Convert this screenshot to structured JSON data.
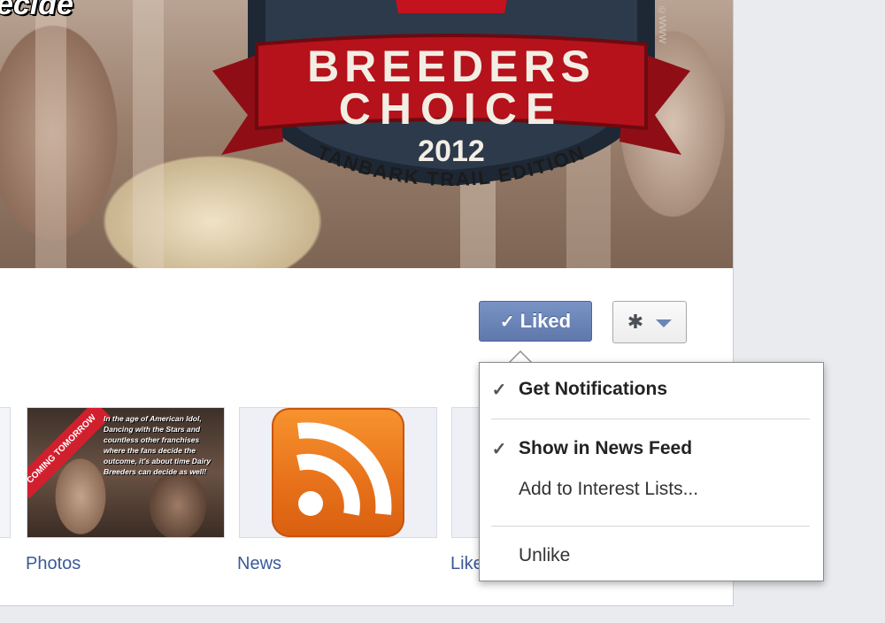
{
  "cover": {
    "caption": "ecide",
    "badge_line1": "BREEDERS",
    "badge_line2": "CHOICE",
    "badge_year": "2012",
    "badge_subtitle": "TANBARK TRAIL EDITION",
    "copyright": "©WWW"
  },
  "actions": {
    "liked_check": "✓",
    "liked_label": "Liked",
    "gear_icon": "gear-icon",
    "chevron_icon": "chevron-down-icon"
  },
  "tiles": {
    "photos": {
      "label": "Photos",
      "banner": "COMING TOMORROW",
      "overlay_text": "In the age of American Idol, Dancing with the Stars and countless other franchises where the fans decide the outcome, it's about time Dairy Breeders can decide as well!"
    },
    "news": {
      "label": "News",
      "icon": "rss-icon"
    },
    "likes": {
      "label": "Like"
    }
  },
  "menu": {
    "items": [
      {
        "label": "Get Notifications",
        "checked": true,
        "check": "✓"
      },
      {
        "label": "Show in News Feed",
        "checked": true,
        "check": "✓"
      },
      {
        "label": "Add to Interest Lists...",
        "checked": false
      },
      {
        "label": "Unlike",
        "checked": false
      }
    ]
  },
  "colors": {
    "facebook_blue": "#3b5998",
    "liked_button": "#6d84b4",
    "rss_orange": "#f7942f",
    "badge_red": "#b5121b"
  }
}
